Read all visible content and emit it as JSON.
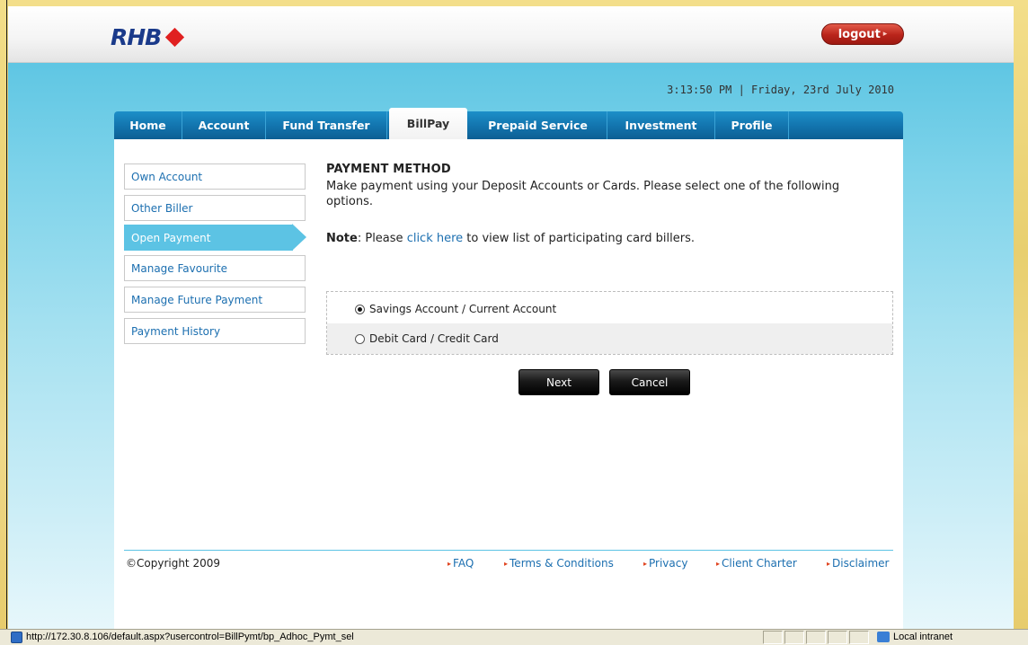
{
  "header": {
    "logo_text": "RHB",
    "logout_label": "logout"
  },
  "datetime": "3:13:50 PM | Friday, 23rd July 2010",
  "tabs": [
    {
      "label": "Home"
    },
    {
      "label": "Account"
    },
    {
      "label": "Fund Transfer"
    },
    {
      "label": "BillPay",
      "active": true
    },
    {
      "label": "Prepaid Service"
    },
    {
      "label": "Investment"
    },
    {
      "label": "Profile"
    }
  ],
  "sidebar": {
    "items": [
      {
        "label": "Own Account"
      },
      {
        "label": "Other Biller"
      },
      {
        "label": "Open Payment",
        "active": true
      },
      {
        "label": "Manage Favourite"
      },
      {
        "label": "Manage Future Payment"
      },
      {
        "label": "Payment History"
      }
    ]
  },
  "main": {
    "title": "PAYMENT METHOD",
    "description": "Make payment using your Deposit Accounts or Cards. Please select one of the following options.",
    "note_label": "Note",
    "note_prefix": ": Please ",
    "note_link": "click here",
    "note_suffix": " to view list of participating card billers.",
    "options": [
      {
        "label": "Savings Account / Current Account",
        "checked": true
      },
      {
        "label": "Debit Card / Credit Card",
        "checked": false
      }
    ],
    "next_label": "Next",
    "cancel_label": "Cancel"
  },
  "footer": {
    "copyright": "©Copyright 2009",
    "links": [
      {
        "label": "FAQ"
      },
      {
        "label": "Terms & Conditions"
      },
      {
        "label": "Privacy"
      },
      {
        "label": "Client Charter"
      },
      {
        "label": "Disclaimer"
      }
    ]
  },
  "statusbar": {
    "url": "http://172.30.8.106/default.aspx?usercontrol=BillPymt/bp_Adhoc_Pymt_sel",
    "zone": "Local intranet"
  },
  "colors": {
    "accent_blue": "#1273ad",
    "light_blue": "#5cc3e4",
    "logout_red": "#b9241a",
    "link_blue": "#1c6fb0"
  }
}
